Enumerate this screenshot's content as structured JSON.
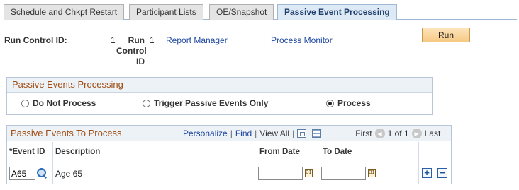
{
  "tabs": [
    {
      "pre": "",
      "under": "S",
      "post": "chedule and Chkpt Restart",
      "active": false
    },
    {
      "pre": "Participant Lists",
      "under": "",
      "post": "",
      "active": false
    },
    {
      "pre": "",
      "under": "O",
      "post": "E/Snapshot",
      "active": false
    },
    {
      "pre": "Passive Event Processing",
      "under": "",
      "post": "",
      "active": true
    }
  ],
  "run_control": {
    "label": "Run Control ID:",
    "value": "1",
    "secondary_label_lines": [
      "Run",
      "Control",
      "ID"
    ],
    "secondary_value": "1",
    "report_manager": "Report Manager",
    "process_monitor": "Process Monitor",
    "run_button": "Run"
  },
  "passive_processing": {
    "title": "Passive Events Processing",
    "options": [
      {
        "label": "Do Not Process",
        "selected": false
      },
      {
        "label": "Trigger Passive Events Only",
        "selected": false
      },
      {
        "label": "Process",
        "selected": true
      }
    ]
  },
  "grid": {
    "title": "Passive Events To Process",
    "nav": {
      "personalize": "Personalize",
      "find": "Find",
      "view_all": "View All",
      "first": "First",
      "range": "1 of 1",
      "last": "Last"
    },
    "columns": [
      "*Event ID",
      "Description",
      "From Date",
      "To Date"
    ],
    "rows": [
      {
        "event_id": "A65",
        "description": "Age 65",
        "from_date": "",
        "to_date": ""
      }
    ]
  },
  "icons": {
    "lookup": "magnifier-icon",
    "calendar": "calendar-icon",
    "add": "plus-icon",
    "delete": "minus-icon"
  },
  "colors": {
    "section_title": "#a14d14",
    "link": "#1f47a0",
    "run_button": "#f6c982"
  }
}
